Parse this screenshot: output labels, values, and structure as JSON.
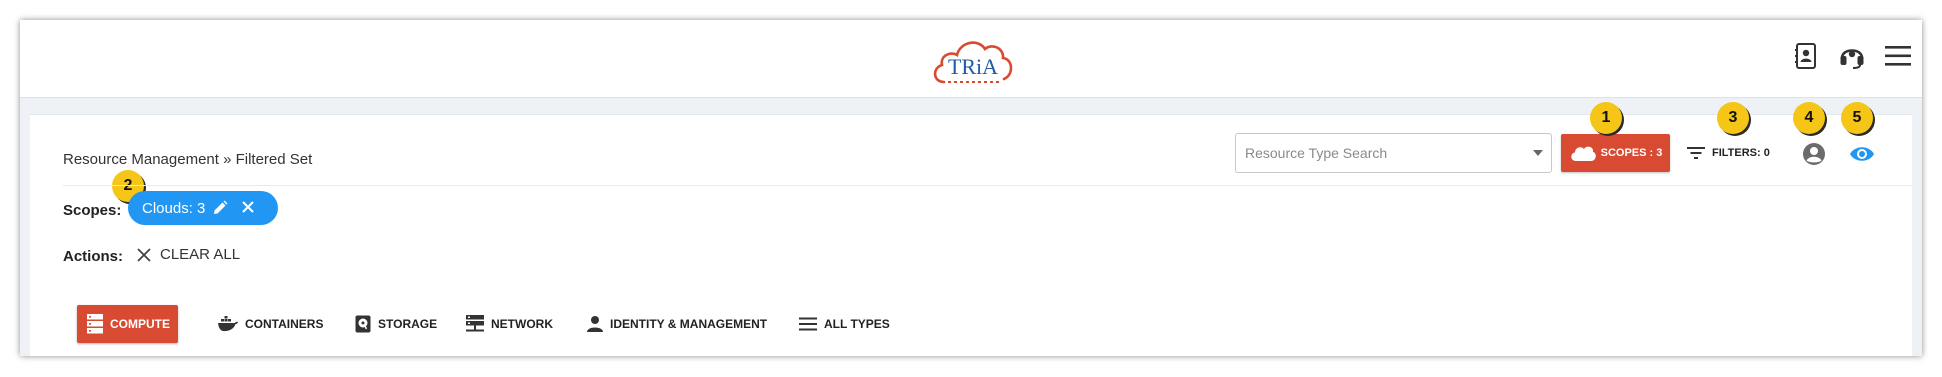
{
  "brand": {
    "logo_text": "TRiA",
    "logo_color": "#d84a31"
  },
  "colors": {
    "accent": "#d84a31",
    "chip": "#2196f3",
    "badge": "#f5c518",
    "eye": "#2196f3"
  },
  "header": {
    "icons": [
      "contact-book-icon",
      "headset-icon",
      "hamburger-menu-icon"
    ]
  },
  "toolbar": {
    "breadcrumb": "Resource Management » Filtered Set",
    "search_placeholder": "Resource Type Search",
    "scopes_label": "SCOPES : 3",
    "filters_label": "FILTERS: 0"
  },
  "badges": [
    "1",
    "2",
    "3",
    "4",
    "5"
  ],
  "scopes": {
    "label": "Scopes:",
    "chip_label": "Clouds: 3"
  },
  "actions": {
    "label": "Actions:",
    "clear_all": "CLEAR ALL"
  },
  "tabs": [
    {
      "label": "COMPUTE",
      "icon": "server-stack-icon",
      "active": true
    },
    {
      "label": "CONTAINERS",
      "icon": "docker-icon",
      "active": false
    },
    {
      "label": "STORAGE",
      "icon": "hard-drive-icon",
      "active": false
    },
    {
      "label": "NETWORK",
      "icon": "network-icon",
      "active": false
    },
    {
      "label": "IDENTITY & MANAGEMENT",
      "icon": "person-icon",
      "active": false
    },
    {
      "label": "ALL TYPES",
      "icon": "list-icon",
      "active": false
    }
  ]
}
